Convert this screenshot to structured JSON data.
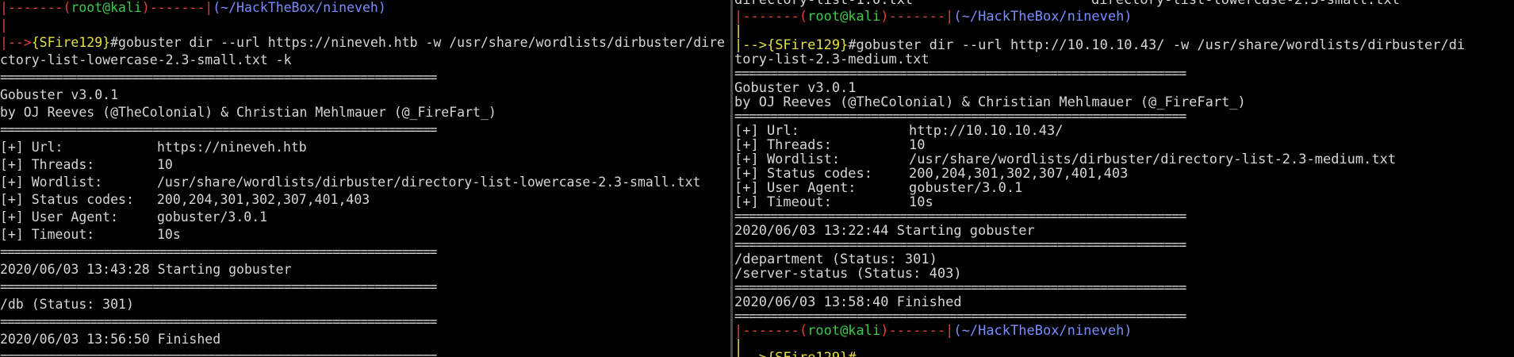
{
  "colors": {
    "background": "#000000",
    "text": "#d6d6d6",
    "prompt_frame": "#e0403a",
    "prompt_user": "#3cc94b",
    "prompt_path": "#7a8cff",
    "prompt_name": "#e5e045"
  },
  "left": {
    "prompt": {
      "dashes_left": "|-------(",
      "user": "root@kali",
      "dashes_right": ")-------|",
      "path": "(~/HackTheBox/nineveh)"
    },
    "bar": "|",
    "cmd_arrow": "|-->",
    "cmd_name": "{SFire129}",
    "cmd_line1": "#gobuster dir --url https://nineveh.htb -w /usr/share/wordlists/dirbuster/dire",
    "cmd_line2": "ctory-list-lowercase-2.3-small.txt -k",
    "sep": "===============================================================",
    "version": "Gobuster v3.0.1",
    "authors": "by OJ Reeves (@TheColonial) & Christian Mehlmauer (@_FireFart_)",
    "config": [
      {
        "label": "[+] Url:",
        "value": "https://nineveh.htb"
      },
      {
        "label": "[+] Threads:",
        "value": "10"
      },
      {
        "label": "[+] Wordlist:",
        "value": "/usr/share/wordlists/dirbuster/directory-list-lowercase-2.3-small.txt"
      },
      {
        "label": "[+] Status codes:",
        "value": "200,204,301,302,307,401,403"
      },
      {
        "label": "[+] User Agent:",
        "value": "gobuster/3.0.1"
      },
      {
        "label": "[+] Timeout:",
        "value": "10s"
      }
    ],
    "start": "2020/06/03 13:43:28 Starting gobuster",
    "results": [
      "/db (Status: 301)"
    ],
    "finish": "2020/06/03 13:56:50 Finished"
  },
  "right": {
    "top_partial_a": "directory-list-1.0.txt",
    "top_partial_b": "directory-list-lowercase-2.3-small.txt",
    "prompt": {
      "dashes_left": "|-------(",
      "user": "root@kali",
      "dashes_right": ")-------|",
      "path": "(~/HackTheBox/nineveh)"
    },
    "bar": "|",
    "cmd_arrow": "|-->",
    "cmd_name": "{SFire129}",
    "cmd_line1": "#gobuster dir --url http://10.10.10.43/ -w /usr/share/wordlists/dirbuster/di",
    "cmd_line2": "tory-list-2.3-medium.txt",
    "sep": "===============================================================",
    "version": "Gobuster v3.0.1",
    "authors": "by OJ Reeves (@TheColonial) & Christian Mehlmauer (@_FireFart_)",
    "config": [
      {
        "label": "[+] Url:",
        "value": "http://10.10.10.43/"
      },
      {
        "label": "[+] Threads:",
        "value": "10"
      },
      {
        "label": "[+] Wordlist:",
        "value": "/usr/share/wordlists/dirbuster/directory-list-2.3-medium.txt"
      },
      {
        "label": "[+] Status codes:",
        "value": "200,204,301,302,307,401,403"
      },
      {
        "label": "[+] User Agent:",
        "value": "gobuster/3.0.1"
      },
      {
        "label": "[+] Timeout:",
        "value": "10s"
      }
    ],
    "start": "2020/06/03 13:22:44 Starting gobuster",
    "results": [
      "/department (Status: 301)",
      "/server-status (Status: 403)"
    ],
    "finish": "2020/06/03 13:58:40 Finished",
    "bottom_prompt_partial": "{SFire129}#"
  }
}
